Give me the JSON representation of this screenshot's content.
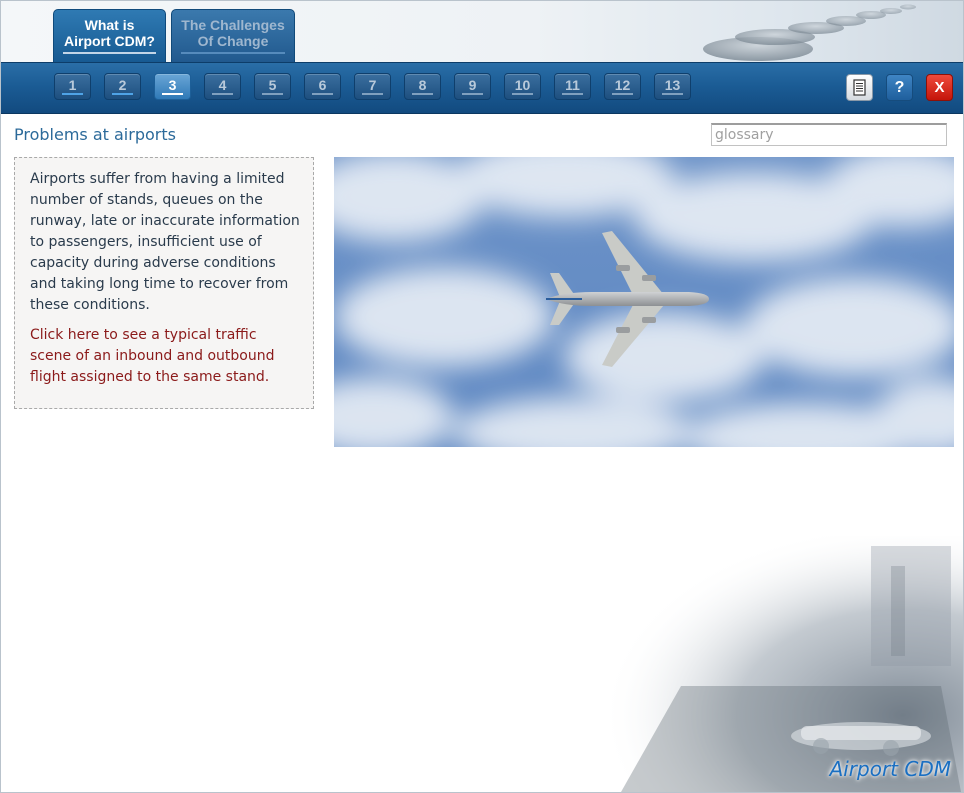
{
  "header": {
    "tabs": [
      {
        "line1": "What is",
        "line2": "Airport CDM?",
        "active": true
      },
      {
        "line1": "The Challenges",
        "line2": "Of Change",
        "active": false
      }
    ]
  },
  "pagination": {
    "pages": [
      "1",
      "2",
      "3",
      "4",
      "5",
      "6",
      "7",
      "8",
      "9",
      "10",
      "11",
      "12",
      "13"
    ],
    "current": "3"
  },
  "toolbar": {
    "notes_icon": "notes-icon",
    "help_label": "?",
    "close_label": "X"
  },
  "content": {
    "title": "Problems at airports",
    "paragraph": "Airports suffer from having a limited number of stands, queues on the runway, late or inaccurate information to passengers, insufficient use of capacity during adverse conditions and taking long time to recover from these conditions.",
    "link_text": "Click here to see a typical traffic scene of an inbound and outbound flight assigned to the same stand."
  },
  "search": {
    "placeholder": "glossary",
    "value": ""
  },
  "footer": {
    "brand": "Airport CDM"
  },
  "colors": {
    "accent": "#1b5c95",
    "link": "#8b1a1a",
    "close": "#d4241a"
  }
}
